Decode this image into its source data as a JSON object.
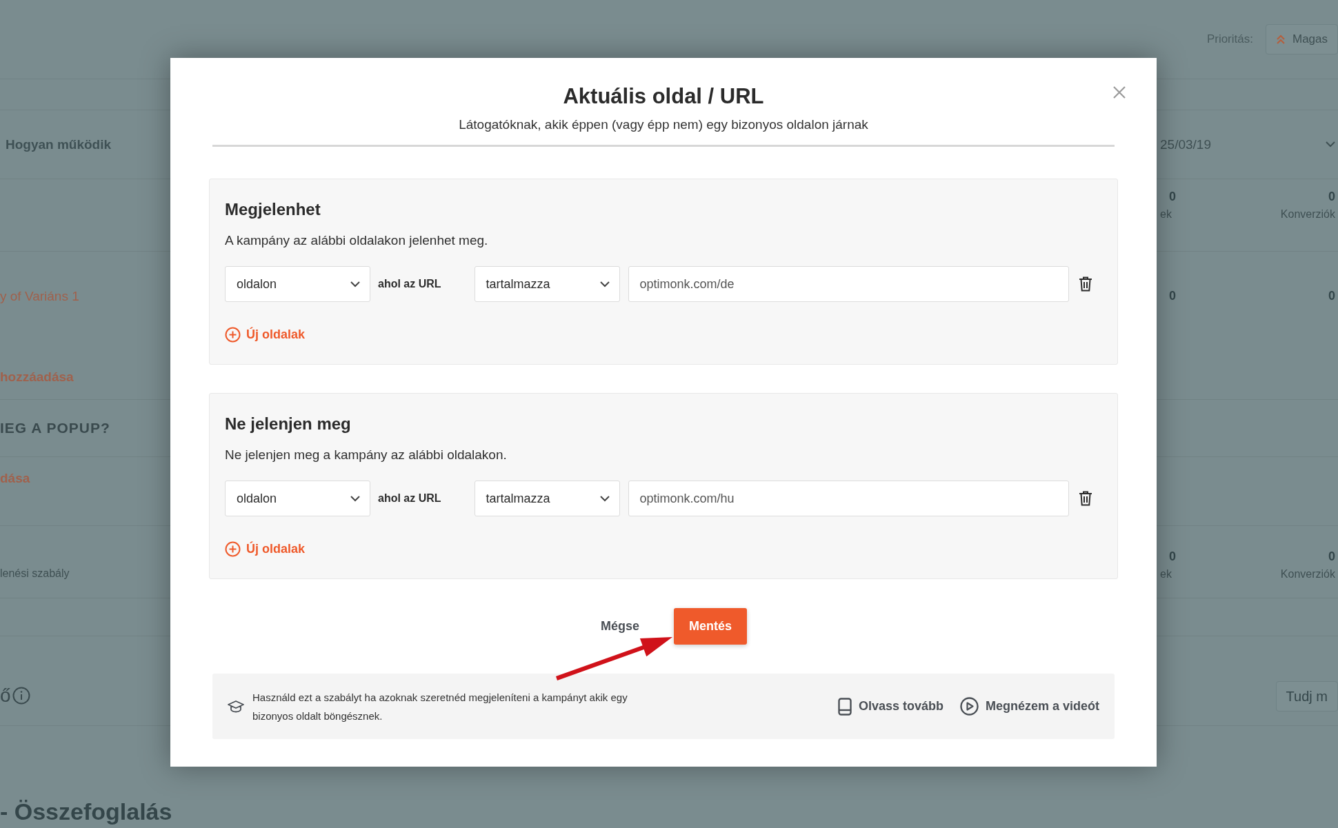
{
  "backdrop": {
    "priority": {
      "label": "Prioritás:",
      "value": "Magas"
    },
    "left": [
      {
        "kind": "link",
        "text": "Hogyan működik"
      },
      {
        "kind": "accent",
        "text": "y of Variáns 1"
      },
      {
        "kind": "accent_bold",
        "text": "hozzáadása"
      },
      {
        "kind": "heading",
        "text": "IEG A POPUP?"
      },
      {
        "kind": "accent_bold",
        "text": "dása"
      },
      {
        "kind": "muted",
        "text": "lenési szabály"
      },
      {
        "kind": "info",
        "text": "ő"
      },
      {
        "kind": "title",
        "text": "- Összefoglalás"
      }
    ],
    "date": "25/03/19",
    "stats": [
      {
        "first": "0",
        "first_label": "ek",
        "second": "0",
        "second_label": "Konverziók"
      },
      {
        "first": "0",
        "second": "0"
      },
      {
        "first": "0",
        "first_label": "ek",
        "second": "0",
        "second_label": "Konverziók"
      }
    ],
    "learn_button": "Tudj m"
  },
  "modal": {
    "title": "Aktuális oldal / URL",
    "subtitle": "Látogatóknak, akik éppen (vagy épp nem) egy bizonyos oldalon járnak",
    "sections": [
      {
        "title": "Megjelenhet",
        "description": "A kampány az alábbi oldalakon jelenhet meg.",
        "rules": [
          {
            "page": "oldalon",
            "connector": "ahol az URL",
            "operator": "tartalmazza",
            "url": "optimonk.com/de"
          }
        ],
        "add_label": "Új oldalak"
      },
      {
        "title": "Ne jelenjen meg",
        "description": "Ne jelenjen meg a kampány az alábbi oldalakon.",
        "rules": [
          {
            "page": "oldalon",
            "connector": "ahol az URL",
            "operator": "tartalmazza",
            "url": "optimonk.com/hu"
          }
        ],
        "add_label": "Új oldalak"
      }
    ],
    "cancel": "Mégse",
    "save": "Mentés",
    "info": {
      "text": "Használd ezt a szabályt ha azoknak szeretnéd megjeleníteni a kampányt akik egy bizonyos oldalt böngésznek.",
      "links": [
        {
          "kind": "book",
          "label": "Olvass tovább"
        },
        {
          "kind": "play",
          "label": "Megnézem a videót"
        }
      ]
    }
  }
}
